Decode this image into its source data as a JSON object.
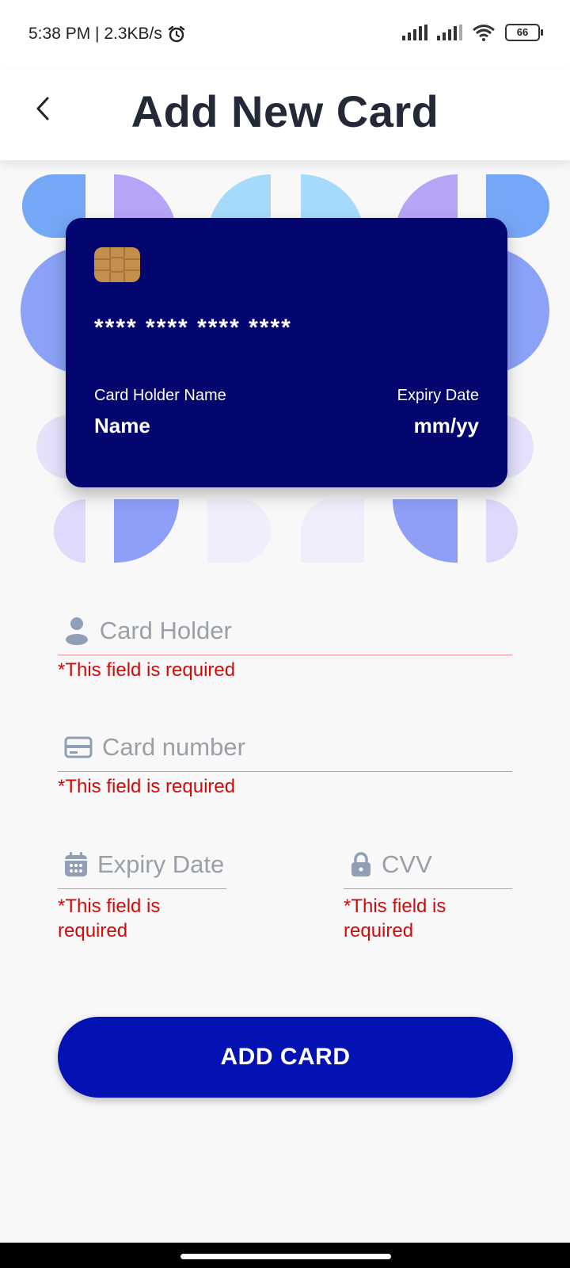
{
  "status_bar": {
    "time": "5:38 PM | 2.3KB/s",
    "battery": "66"
  },
  "header": {
    "title": "Add New Card"
  },
  "card_preview": {
    "number": "**** **** **** ****",
    "holder_label": "Card Holder Name",
    "holder_value": "Name",
    "expiry_label": "Expiry Date",
    "expiry_value": "mm/yy",
    "color": "#03066f"
  },
  "form": {
    "card_holder": {
      "placeholder": "Card Holder",
      "value": "",
      "error": "*This field is required"
    },
    "card_number": {
      "placeholder": "Card number",
      "value": "",
      "error": "*This field is required"
    },
    "expiry_date": {
      "placeholder": "Expiry Date",
      "value": "",
      "error": "*This field is required"
    },
    "cvv": {
      "placeholder": "CVV",
      "value": "",
      "error": "*This field is required"
    }
  },
  "actions": {
    "add_card_label": "ADD CARD"
  },
  "colors": {
    "primary": "#0512b3",
    "error": "#d00a0a",
    "text": "#232937"
  },
  "icons": [
    "back-arrow-icon",
    "alarm-icon",
    "signal-icon",
    "wifi-icon",
    "battery-icon",
    "chip-icon",
    "person-icon",
    "card-icon",
    "calendar-icon",
    "lock-icon"
  ]
}
